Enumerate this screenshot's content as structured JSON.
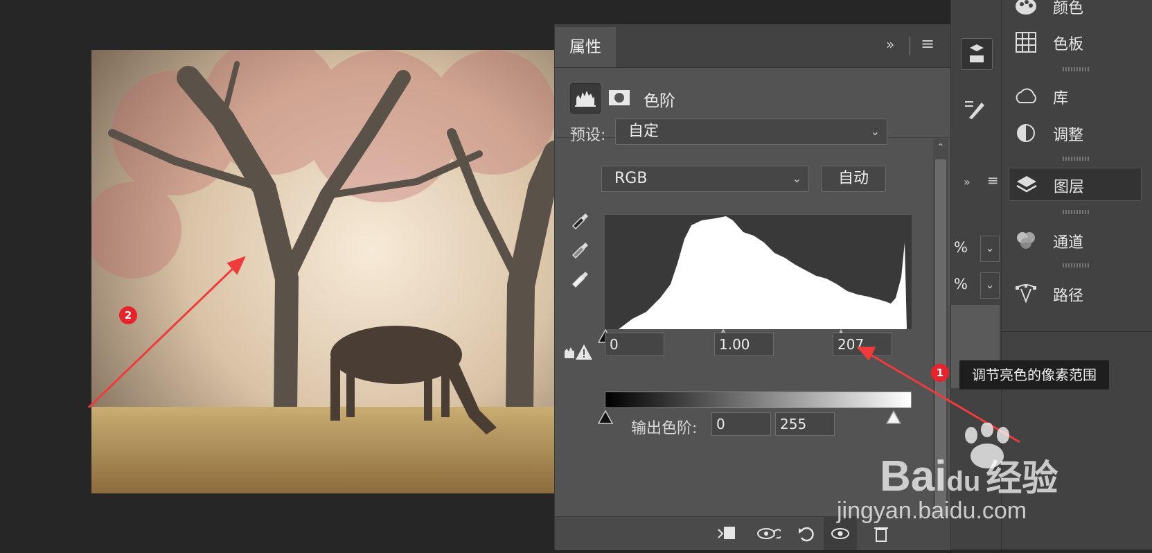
{
  "properties_panel": {
    "tab_label": "属性",
    "expand_symbol": "»",
    "menu_symbol": "≡",
    "adjustment_title": "色阶",
    "preset_label": "预设:",
    "preset_value": "自定",
    "channel_value": "RGB",
    "auto_label": "自动",
    "input_levels": {
      "black": "0",
      "gamma": "1.00",
      "white": "207"
    },
    "output_label": "输出色阶:",
    "output_levels": {
      "black": "0",
      "white": "255"
    }
  },
  "right_panels": {
    "items": [
      {
        "label": "颜色",
        "icon": "palette-icon"
      },
      {
        "label": "色板",
        "icon": "swatches-grid-icon"
      },
      {
        "label": "库",
        "icon": "cloud-libraries-icon"
      },
      {
        "label": "调整",
        "icon": "half-circle-adjust-icon"
      },
      {
        "label": "图层",
        "icon": "layers-icon"
      },
      {
        "label": "通道",
        "icon": "channels-icon"
      },
      {
        "label": "路径",
        "icon": "pen-path-icon"
      }
    ]
  },
  "mid_column": {
    "pct_1": "%",
    "pct_2": "%"
  },
  "annotations": {
    "marker_1": "1",
    "marker_2": "2",
    "tooltip_text": "调节亮色的像素范围",
    "arrow_color": "#ef3b3b"
  },
  "watermark": {
    "brand_text": "Bai",
    "du_text": "du",
    "jingyan_text": "经验",
    "url_text": "jingyan.baidu.com"
  }
}
